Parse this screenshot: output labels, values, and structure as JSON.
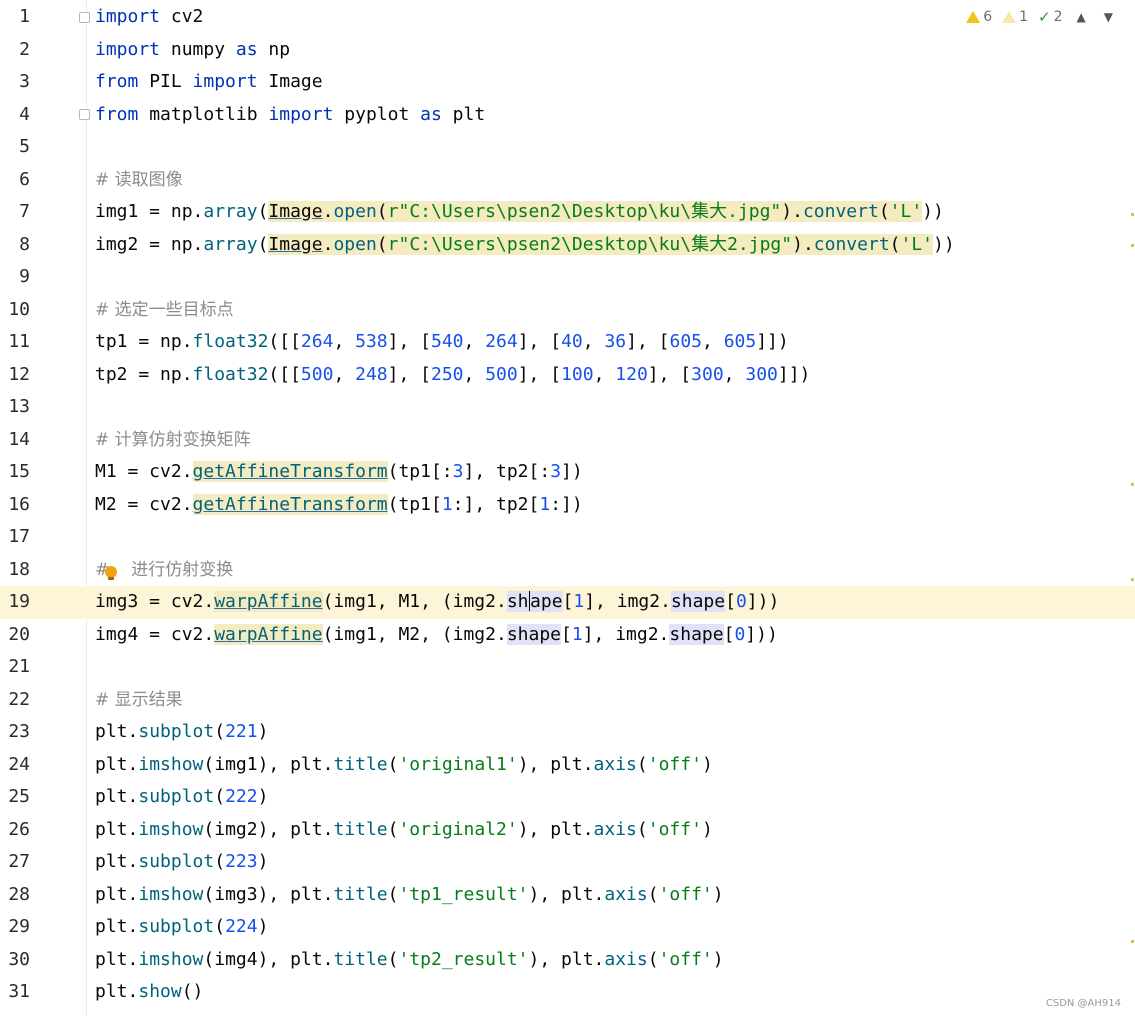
{
  "editor": {
    "inspections": {
      "warnings": "6",
      "weak_warnings": "1",
      "typos": "2"
    },
    "line_numbers": [
      "1",
      "2",
      "3",
      "4",
      "5",
      "6",
      "7",
      "8",
      "9",
      "10",
      "11",
      "12",
      "13",
      "14",
      "15",
      "16",
      "17",
      "18",
      "19",
      "20",
      "21",
      "22",
      "23",
      "24",
      "25",
      "26",
      "27",
      "28",
      "29",
      "30",
      "31"
    ],
    "current_line": "19",
    "lines": {
      "l1": [
        "import",
        " cv2"
      ],
      "l2": [
        "import",
        " numpy ",
        "as",
        " np"
      ],
      "l3": [
        "from",
        " PIL ",
        "import",
        " Image"
      ],
      "l4": [
        "from",
        " matplotlib ",
        "import",
        " pyplot ",
        "as",
        " plt"
      ],
      "l6": "# 读取图像",
      "l7": [
        "img1 = np.",
        "array",
        "(",
        "Image",
        ".",
        "open",
        "(",
        "r\"C:\\Users\\psen2\\Desktop\\ku\\集大.jpg\"",
        ").",
        "convert",
        "(",
        "'L'",
        "))"
      ],
      "l8": [
        "img2 = np.",
        "array",
        "(",
        "Image",
        ".",
        "open",
        "(",
        "r\"C:\\Users\\psen2\\Desktop\\ku\\集大2.jpg\"",
        ").",
        "convert",
        "(",
        "'L'",
        "))"
      ],
      "l10": "# 选定一些目标点",
      "l11": [
        "tp1 = np.",
        "float32",
        "([[",
        "264",
        ", ",
        "538",
        "], [",
        "540",
        ", ",
        "264",
        "], [",
        "40",
        ", ",
        "36",
        "], [",
        "605",
        ", ",
        "605",
        "]])"
      ],
      "l12": [
        "tp2 = np.",
        "float32",
        "([[",
        "500",
        ", ",
        "248",
        "], [",
        "250",
        ", ",
        "500",
        "], [",
        "100",
        ", ",
        "120",
        "], [",
        "300",
        ", ",
        "300",
        "]])"
      ],
      "l14": "# 计算仿射变换矩阵",
      "l15": [
        "M1 = cv2.",
        "getAffineTransform",
        "(tp1[:",
        "3",
        "], tp2[:",
        "3",
        "])"
      ],
      "l16": [
        "M2 = cv2.",
        "getAffineTransform",
        "(tp1[",
        "1",
        ":], tp2[",
        "1",
        ":])"
      ],
      "l18a": "#",
      "l18b": "进行仿射变换",
      "l19": [
        "img3 = cv2.",
        "warpAffine",
        "(img1, M1, (img2.",
        "sh",
        "ape",
        "[",
        "1",
        "], img2.",
        "shape",
        "[",
        "0",
        "]))"
      ],
      "l20": [
        "img4 = cv2.",
        "warpAffine",
        "(img1, M2, (img2.",
        "shape",
        "[",
        "1",
        "], img2.",
        "shape",
        "[",
        "0",
        "]))"
      ],
      "l22": "# 显示结果",
      "l23": [
        "plt.",
        "subplot",
        "(",
        "221",
        ")"
      ],
      "l24": [
        "plt.",
        "imshow",
        "(img1), plt.",
        "title",
        "(",
        "'original1'",
        "), plt.",
        "axis",
        "(",
        "'off'",
        ")"
      ],
      "l25": [
        "plt.",
        "subplot",
        "(",
        "222",
        ")"
      ],
      "l26": [
        "plt.",
        "imshow",
        "(img2), plt.",
        "title",
        "(",
        "'original2'",
        "), plt.",
        "axis",
        "(",
        "'off'",
        ")"
      ],
      "l27": [
        "plt.",
        "subplot",
        "(",
        "223",
        ")"
      ],
      "l28": [
        "plt.",
        "imshow",
        "(img3), plt.",
        "title",
        "(",
        "'tp1_result'",
        "), plt.",
        "axis",
        "(",
        "'off'",
        ")"
      ],
      "l29": [
        "plt.",
        "subplot",
        "(",
        "224",
        ")"
      ],
      "l30": [
        "plt.",
        "imshow",
        "(img4), plt.",
        "title",
        "(",
        "'tp2_result'",
        "), plt.",
        "axis",
        "(",
        "'off'",
        ")"
      ],
      "l31": [
        "plt.",
        "show",
        "()"
      ]
    }
  },
  "watermark": "CSDN @AH914",
  "colors": {
    "keyword": "#0033b3",
    "function": "#00627a",
    "number": "#1750eb",
    "string": "#067d17",
    "comment": "#8c8c8c",
    "current_line": "#fcf5d7"
  },
  "icons": [
    "warning-icon",
    "weak-warning-icon",
    "typo-check-icon",
    "chevron-up-icon",
    "chevron-down-icon",
    "intention-bulb-icon",
    "fold-marker-icon"
  ]
}
